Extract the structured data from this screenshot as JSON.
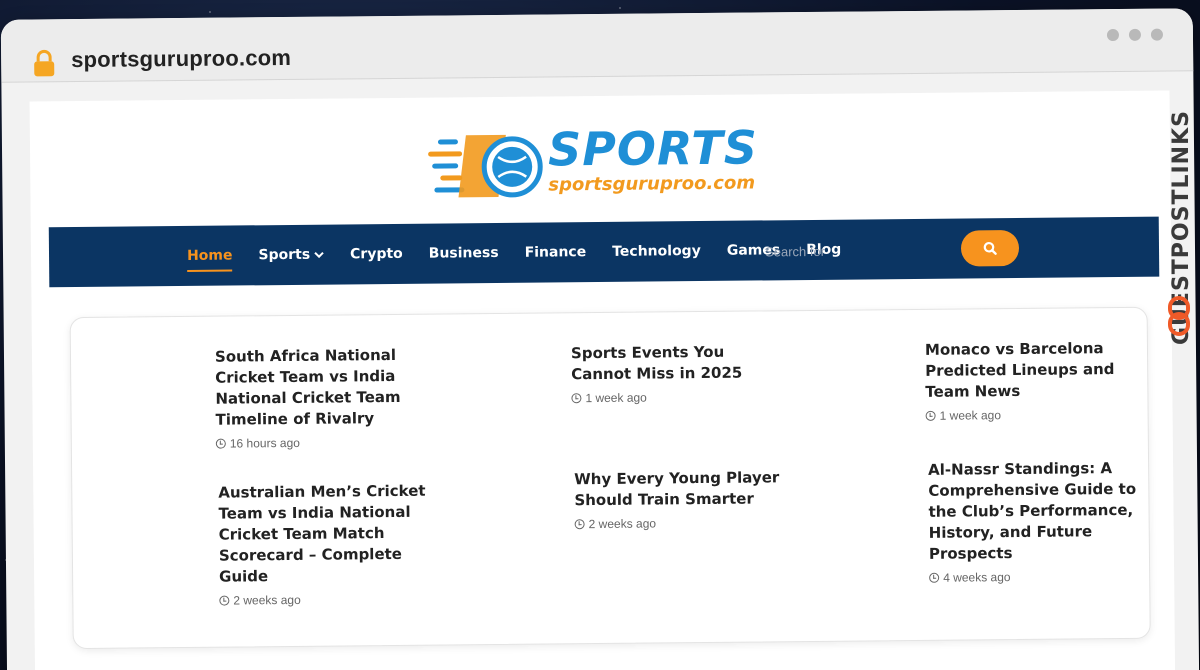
{
  "browser": {
    "url": "sportsguruproo.com"
  },
  "site": {
    "logo_word": "SPORTS",
    "logo_domain": "sportsguruproo.com"
  },
  "nav": {
    "items": [
      {
        "label": "Home",
        "active": true
      },
      {
        "label": "Sports",
        "dropdown": true
      },
      {
        "label": "Crypto"
      },
      {
        "label": "Business"
      },
      {
        "label": "Finance"
      },
      {
        "label": "Technology"
      },
      {
        "label": "Games"
      },
      {
        "label": "Blog"
      }
    ],
    "search_placeholder": "Search for"
  },
  "posts": [
    {
      "title": "South Africa National Cricket Team vs India National Cricket Team Timeline of Rivalry",
      "time": "16 hours ago"
    },
    {
      "title": "Sports Events You Cannot Miss in 2025",
      "time": "1 week ago"
    },
    {
      "title": "Monaco vs Barcelona Predicted Lineups and Team News",
      "time": "1 week ago"
    },
    {
      "title": "Australian Men’s Cricket Team vs India National Cricket Team Match Scorecard – Complete Guide",
      "time": "2 weeks ago"
    },
    {
      "title": "Why Every Young Player Should Train Smarter",
      "time": "2 weeks ago"
    },
    {
      "title": "Al-Nassr Standings: A Comprehensive Guide to the Club’s Performance, History, and Future Prospects",
      "time": "4 weeks ago"
    }
  ],
  "watermark": "GUESTPOSTLINKS",
  "colors": {
    "nav_bg": "#0b3563",
    "accent": "#f7931e",
    "logo_blue": "#1f8fd6"
  }
}
